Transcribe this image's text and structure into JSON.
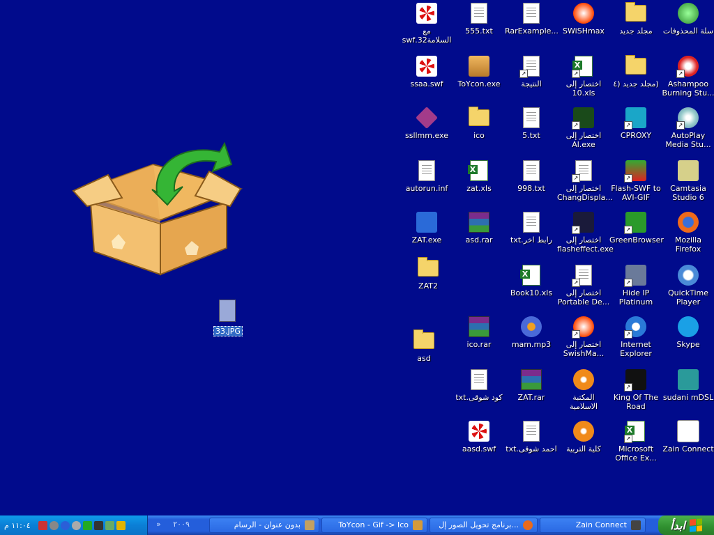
{
  "desktop": {
    "icons": [
      {
        "name": "recycle-bin-icon",
        "label": "سلة المحذوفات",
        "kind": "recycle"
      },
      {
        "name": "folder-icon",
        "label": "مجلد جديد",
        "kind": "folder"
      },
      {
        "name": "swishmax-icon",
        "label": "SWiSHmax",
        "kind": "swish"
      },
      {
        "name": "rar-example-icon",
        "label": "RarExample...",
        "kind": "doc"
      },
      {
        "name": "text-file-icon",
        "label": "555.txt",
        "kind": "doc"
      },
      {
        "name": "swf-file-icon",
        "label": "مع\nالسلامة32.swf",
        "kind": "swf"
      },
      {
        "name": "ashampoo-icon",
        "label": "Ashampoo\nBurning Stu...",
        "kind": "ashampoo",
        "shortcut": true
      },
      {
        "name": "folder-icon",
        "label": "(مجلد جديد (٤",
        "kind": "folder"
      },
      {
        "name": "excel-shortcut-icon",
        "label": "اختصار إلى\n10.xls",
        "kind": "xls",
        "shortcut": true
      },
      {
        "name": "result-file-icon",
        "label": "النتيجة",
        "kind": "doc",
        "shortcut": true
      },
      {
        "name": "toycon-icon",
        "label": "ToYcon.exe",
        "kind": "toycon"
      },
      {
        "name": "swf-file-icon",
        "label": "ssaa.swf",
        "kind": "swf"
      },
      {
        "name": "autoplay-icon",
        "label": "AutoPlay\nMedia Stu...",
        "kind": "autoplay",
        "shortcut": true
      },
      {
        "name": "cproxy-icon",
        "label": "CPROXY",
        "kind": "cproxy",
        "shortcut": true
      },
      {
        "name": "quran-shortcut-icon",
        "label": "اختصار إلى\nAl.exe",
        "kind": "quran",
        "shortcut": true
      },
      {
        "name": "text-file-icon",
        "label": "5.txt",
        "kind": "doc"
      },
      {
        "name": "folder-icon",
        "label": "ico",
        "kind": "folder"
      },
      {
        "name": "exe-file-icon",
        "label": "ssllmm.exe",
        "kind": "sslm"
      },
      {
        "name": "camtasia-icon",
        "label": "Camtasia\nStudio 6",
        "kind": "camtasia"
      },
      {
        "name": "flash-swf-icon",
        "label": "Flash-SWF to\nAVI-GIF",
        "kind": "flashswf",
        "shortcut": true
      },
      {
        "name": "shortcut-icon",
        "label": "اختصار إلى\nChangDispla...",
        "kind": "doc",
        "shortcut": true
      },
      {
        "name": "text-file-icon",
        "label": "998.txt",
        "kind": "doc"
      },
      {
        "name": "excel-file-icon",
        "label": "zat.xls",
        "kind": "xls"
      },
      {
        "name": "inf-file-icon",
        "label": "autorun.inf",
        "kind": "doc"
      },
      {
        "name": "firefox-icon",
        "label": "Mozilla Firefox",
        "kind": "firefox"
      },
      {
        "name": "greenbrowser-icon",
        "label": "GreenBrowser",
        "kind": "greenbrowser",
        "shortcut": true
      },
      {
        "name": "flasheffect-icon",
        "label": "اختصار إلى\nflasheffect.exe",
        "kind": "flasheffect",
        "shortcut": true
      },
      {
        "name": "text-file-icon",
        "label": "رابط اخر.txt",
        "kind": "doc"
      },
      {
        "name": "rar-file-icon",
        "label": "asd.rar",
        "kind": "rar"
      },
      {
        "name": "zat-exe-icon",
        "label": "ZAT.exe",
        "kind": "zatexe"
      },
      {
        "name": "quicktime-icon",
        "label": "QuickTime\nPlayer",
        "kind": "quicktime"
      },
      {
        "name": "hide-ip-icon",
        "label": "Hide IP\nPlatinum",
        "kind": "hideip",
        "shortcut": true
      },
      {
        "name": "portable-shortcut-icon",
        "label": "اختصار إلى\nPortable De...",
        "kind": "doc",
        "shortcut": true
      },
      {
        "name": "excel-file-icon",
        "label": "Book10.xls",
        "kind": "xls"
      },
      {
        "name": "folder-icon",
        "label": "ZAT2",
        "kind": "folder"
      },
      {
        "name": "skype-icon",
        "label": "Skype",
        "kind": "skype"
      },
      {
        "name": "ie-icon",
        "label": "Internet\nExplorer",
        "kind": "ie",
        "shortcut": true
      },
      {
        "name": "swishmax-shortcut-icon",
        "label": "اختصار إلى\nSwishMa...",
        "kind": "swish",
        "shortcut": true
      },
      {
        "name": "mp3-file-icon",
        "label": "mam.mp3",
        "kind": "mp3"
      },
      {
        "name": "rar-file-icon",
        "label": "ico.rar",
        "kind": "rar"
      },
      {
        "name": "folder-icon",
        "label": "asd",
        "kind": "folder"
      },
      {
        "name": "sudani-icon",
        "label": "sudani mDSL",
        "kind": "sudani"
      },
      {
        "name": "king-of-road-icon",
        "label": "King Of The\nRoad",
        "kind": "king",
        "shortcut": true
      },
      {
        "name": "library-icon",
        "label": "المكتبة\nالاسلامية",
        "kind": "disc"
      },
      {
        "name": "rar-file-icon",
        "label": "ZAT.rar",
        "kind": "rar"
      },
      {
        "name": "text-file-icon",
        "label": "كود شوقى.txt",
        "kind": "doc"
      },
      {
        "name": "zain-connect-icon",
        "label": "Zain Connect",
        "kind": "zain"
      },
      {
        "name": "office-excel-icon",
        "label": "Microsoft\nOffice Ex...",
        "kind": "xls",
        "shortcut": true
      },
      {
        "name": "college-icon",
        "label": "كلية التربية",
        "kind": "disc"
      },
      {
        "name": "text-file-icon",
        "label": "احمد شوقى.txt",
        "kind": "doc"
      },
      {
        "name": "swf-file-icon",
        "label": "aasd.swf",
        "kind": "swf"
      }
    ],
    "selected_file": {
      "label": "33.JPG"
    }
  },
  "taskbar": {
    "start_label": "ابدأ",
    "tasks": [
      {
        "label": "Zain Connect",
        "color": "#444"
      },
      {
        "label": "برنامج تحويل الصور إل...",
        "color": "#e96a1c"
      },
      {
        "label": "ToYcon - Gif -> Ico",
        "color": "#d49a3a"
      },
      {
        "label": "بدون عنوان - الرسام",
        "color": "#c2a060"
      }
    ],
    "quick_launch_year": "٢٠٠٩",
    "quick_launch_arrows": "»",
    "clock": "١١:٠٤ م"
  }
}
